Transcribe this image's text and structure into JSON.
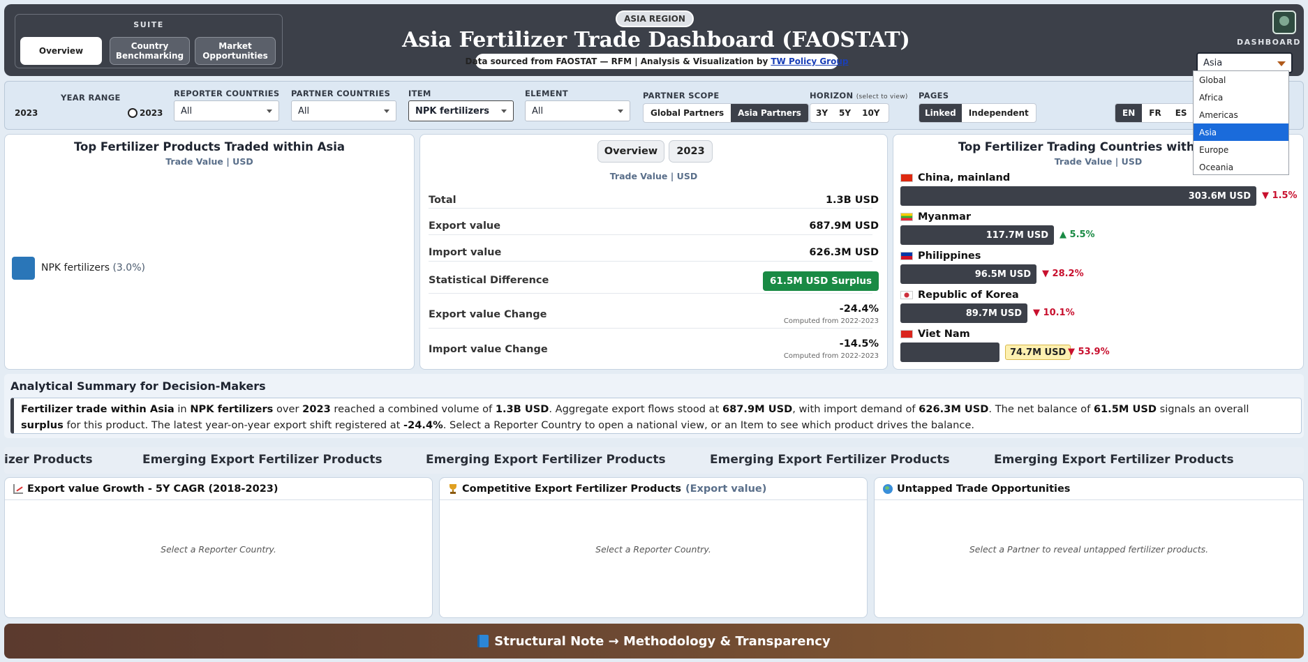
{
  "header": {
    "suite_title": "SUITE",
    "suite_tabs": [
      {
        "label": "Overview",
        "active": true
      },
      {
        "label": "Country Benchmarking",
        "active": false
      },
      {
        "label": "Market Opportunities",
        "active": false
      }
    ],
    "region_badge": "ASIA REGION",
    "title": "Asia Fertilizer Trade Dashboard (FAOSTAT)",
    "source_text": "Data sourced from FAOSTAT — RFM | Analysis & Visualization by",
    "source_link": "TW Policy Group",
    "dashboard_label": "DASHBOARD",
    "dashboard_selected": "Asia",
    "dashboard_options": [
      "Global",
      "Africa",
      "Americas",
      "Asia",
      "Europe",
      "Oceania"
    ]
  },
  "filters": {
    "year_range_label": "YEAR RANGE",
    "year_start": "2023",
    "year_end": "2023",
    "reporter_label": "REPORTER COUNTRIES",
    "reporter_value": "All",
    "partner_label": "PARTNER COUNTRIES",
    "partner_value": "All",
    "item_label": "ITEM",
    "item_value": "NPK fertilizers",
    "element_label": "ELEMENT",
    "element_value": "All",
    "scope_label": "PARTNER SCOPE",
    "scope_options": [
      "Global Partners",
      "Asia Partners"
    ],
    "scope_active": "Asia Partners",
    "horizon_label": "HORIZON",
    "horizon_hint": "(select to view)",
    "horizon_options": [
      "3Y",
      "5Y",
      "10Y"
    ],
    "pages_label": "PAGES",
    "pages_options": [
      "Linked",
      "Independent"
    ],
    "pages_active": "Linked",
    "languages": [
      "EN",
      "FR",
      "ES"
    ],
    "language_active": "EN"
  },
  "products_panel": {
    "title": "Top Fertilizer Products Traded within Asia",
    "subtitle": "Trade Value | USD",
    "legend_name": "NPK fertilizers",
    "legend_pct": "(3.0%)",
    "legend_color": "#2a76b8"
  },
  "kpi_panel": {
    "tabs": [
      "Overview",
      "2023"
    ],
    "subtitle": "Trade Value | USD",
    "rows": [
      {
        "label": "Total",
        "value": "1.3B USD"
      },
      {
        "label": "Export value",
        "value": "687.9M USD"
      },
      {
        "label": "Import value",
        "value": "626.3M USD"
      },
      {
        "label": "Statistical Difference",
        "value": "61.5M USD Surplus"
      },
      {
        "label": "Export value Change",
        "value": "-24.4%",
        "note": "Computed from 2022-2023"
      },
      {
        "label": "Import value Change",
        "value": "-14.5%",
        "note": "Computed from 2022-2023"
      }
    ],
    "surplus_color": "#198a44"
  },
  "countries_panel": {
    "title": "Top Fertilizer Trading Countries within Asia",
    "subtitle": "Trade Value | USD",
    "countries": [
      {
        "name": "China, mainland",
        "value": "303.6M USD",
        "value_num": 303.6,
        "change": "1.5%",
        "direction": "down"
      },
      {
        "name": "Myanmar",
        "value": "117.7M USD",
        "value_num": 117.7,
        "change": "5.5%",
        "direction": "up"
      },
      {
        "name": "Philippines",
        "value": "96.5M USD",
        "value_num": 96.5,
        "change": "28.2%",
        "direction": "down"
      },
      {
        "name": "Republic of Korea",
        "value": "89.7M USD",
        "value_num": 89.7,
        "change": "10.1%",
        "direction": "down"
      },
      {
        "name": "Viet Nam",
        "value": "74.7M USD",
        "value_num": 74.7,
        "change": "53.9%",
        "direction": "down"
      }
    ]
  },
  "summary": {
    "title": "Analytical Summary for Decision-Makers",
    "p1": "Fertilizer trade within Asia",
    "p2": " in ",
    "p3": "NPK fertilizers",
    "p4": " over ",
    "p5": "2023",
    "p6": " reached a combined volume of ",
    "p7": "1.3B USD",
    "p8": ". Aggregate export flows stood at ",
    "p9": "687.9M USD",
    "p10": ", with import demand of ",
    "p11": "626.3M USD",
    "p12": ". The net balance of ",
    "p13": "61.5M USD",
    "p14": " signals an overall ",
    "p15": "surplus",
    "p16": " for this product. The latest year-on-year export shift registered at ",
    "p17": "-24.4%",
    "p18": ". Select a Reporter Country to open a national view, or an Item to see which product drives the balance."
  },
  "ticker": {
    "items": [
      "izer Products",
      "Emerging Export Fertilizer Products",
      "Emerging Export Fertilizer Products",
      "Emerging Export Fertilizer Products",
      "Emerging Export Fertilizer Products"
    ]
  },
  "cards": [
    {
      "title": "Export value Growth - 5Y CAGR (2018-2023)",
      "accent": "",
      "icon": "chart-icon",
      "empty": "Select a Reporter Country."
    },
    {
      "title": "Competitive Export Fertilizer Products",
      "accent": "(Export value)",
      "icon": "trophy-icon",
      "empty": "Select a Reporter Country."
    },
    {
      "title": "Untapped Trade Opportunities",
      "accent": "",
      "icon": "globe-icon",
      "empty": "Select a Partner to reveal untapped fertilizer products."
    }
  ],
  "footer": {
    "label": "Structural Note → Methodology & Transparency"
  }
}
